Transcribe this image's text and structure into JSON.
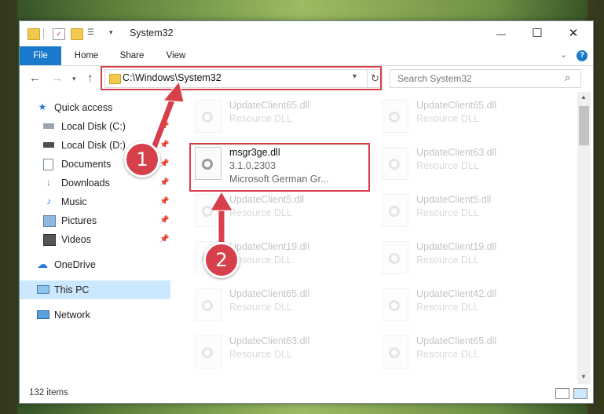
{
  "window": {
    "title": "System32",
    "controls": {
      "minimize": "—",
      "maximize": "☐",
      "close": "✕"
    }
  },
  "ribbon": {
    "tabs": [
      "File",
      "Home",
      "Share",
      "View"
    ],
    "help": "?"
  },
  "address": {
    "path": "C:\\Windows\\System32",
    "search_placeholder": "Search System32"
  },
  "sidebar": {
    "items": [
      {
        "label": "Quick access",
        "icon": "star-icon"
      },
      {
        "label": "Local Disk (C:)",
        "icon": "drive-icon",
        "pinned": true
      },
      {
        "label": "Local Disk (D:)",
        "icon": "drive-icon",
        "pinned": true
      },
      {
        "label": "Documents",
        "icon": "documents-icon",
        "pinned": true
      },
      {
        "label": "Downloads",
        "icon": "download-icon",
        "pinned": true
      },
      {
        "label": "Music",
        "icon": "music-icon",
        "pinned": true
      },
      {
        "label": "Pictures",
        "icon": "pictures-icon",
        "pinned": true
      },
      {
        "label": "Videos",
        "icon": "videos-icon",
        "pinned": true
      },
      {
        "label": "OneDrive",
        "icon": "cloud-icon"
      },
      {
        "label": "This PC",
        "icon": "pc-icon",
        "selected": true
      },
      {
        "label": "Network",
        "icon": "network-icon"
      }
    ]
  },
  "files": {
    "highlighted": {
      "name": "msgr3ge.dll",
      "version": "3.1.0.2303",
      "description": "Microsoft German Gr..."
    },
    "left_column": [
      {
        "name": "UpdateClient65.dll",
        "description": "Resource DLL"
      },
      {
        "name": "UpdateClient5.dll",
        "description": "Resource DLL"
      },
      {
        "name": "UpdateClient19.dll",
        "description": "Resource DLL"
      },
      {
        "name": "UpdateClient65.dll",
        "description": "Resource DLL"
      },
      {
        "name": "UpdateClient63.dll",
        "description": "Resource DLL"
      }
    ],
    "right_column": [
      {
        "name": "UpdateClient65.dll",
        "description": "Resource DLL"
      },
      {
        "name": "UpdateClient63.dll",
        "description": "Resource DLL"
      },
      {
        "name": "UpdateClient5.dll",
        "description": "Resource DLL"
      },
      {
        "name": "UpdateClient19.dll",
        "description": "Resource DLL"
      },
      {
        "name": "UpdateClient42.dll",
        "description": "Resource DLL"
      },
      {
        "name": "UpdateClient65.dll",
        "description": "Resource DLL"
      }
    ]
  },
  "status": {
    "item_count": "132 items"
  },
  "annotations": {
    "step1": "1",
    "step2": "2",
    "color": "#d6404a"
  }
}
